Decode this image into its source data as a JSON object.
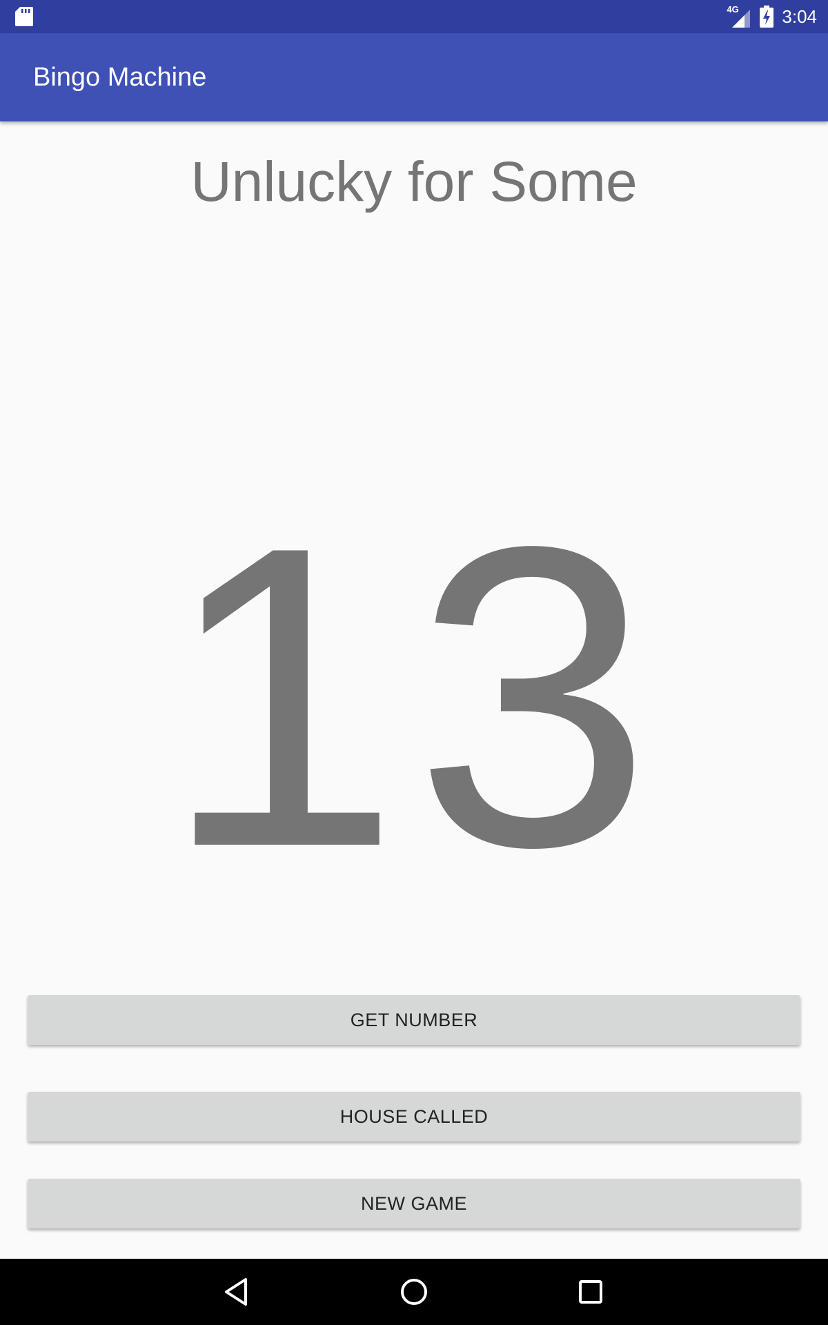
{
  "status_bar": {
    "network": "4G",
    "time": "3:04"
  },
  "app_bar": {
    "title": "Bingo Machine"
  },
  "main": {
    "call_phrase": "Unlucky for Some",
    "number": "13"
  },
  "buttons": {
    "get_number": "GET NUMBER",
    "house_called": "HOUSE CALLED",
    "new_game": "NEW GAME"
  },
  "colors": {
    "status_bar": "#303f9f",
    "app_bar": "#3f51b5",
    "text_gray": "#757575",
    "button_bg": "#d6d7d7"
  },
  "icons": {
    "sd_card": "sd-card-icon",
    "signal": "signal-icon",
    "battery": "battery-charging-icon",
    "back": "back-icon",
    "home": "home-icon",
    "recent": "recent-apps-icon"
  }
}
